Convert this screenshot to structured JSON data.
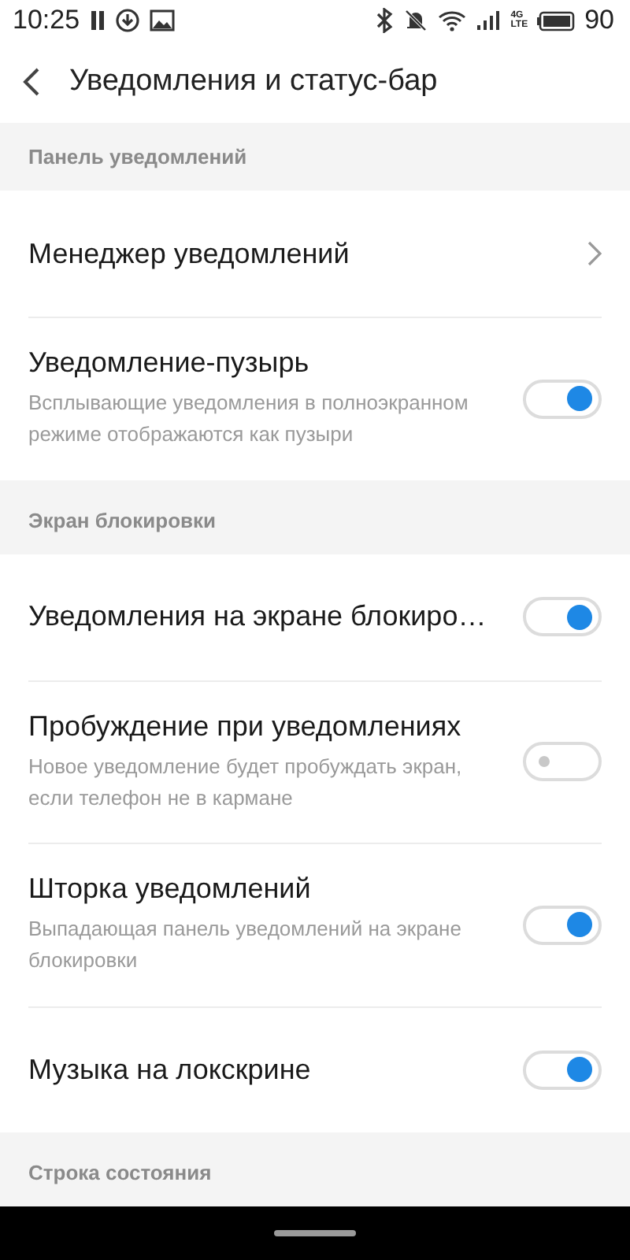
{
  "status_bar": {
    "time": "10:25",
    "network_top": "4G",
    "network_bottom": "LTE",
    "battery": "90"
  },
  "header": {
    "title": "Уведомления и статус-бар"
  },
  "sections": [
    {
      "title": "Панель уведомлений",
      "items": [
        {
          "kind": "link",
          "title": "Менеджер уведомлений"
        },
        {
          "kind": "toggle",
          "title": "Уведомление-пузырь",
          "subtitle": "Всплывающие уведомления в полноэкранном режиме отображаются как пузыри",
          "on": true
        }
      ]
    },
    {
      "title": "Экран блокировки",
      "items": [
        {
          "kind": "toggle",
          "title": "Уведомления на экране блокиро…",
          "on": true
        },
        {
          "kind": "toggle",
          "title": "Пробуждение при уведомлениях",
          "subtitle": "Новое уведомление будет пробуждать экран, если телефон не в кармане",
          "on": false
        },
        {
          "kind": "toggle",
          "title": "Шторка уведомлений",
          "subtitle": "Выпадающая панель уведомлений на экране блокировки",
          "on": true
        },
        {
          "kind": "toggle",
          "title": "Музыка на локскрине",
          "on": true
        }
      ]
    },
    {
      "title": "Строка состояния"
    }
  ]
}
